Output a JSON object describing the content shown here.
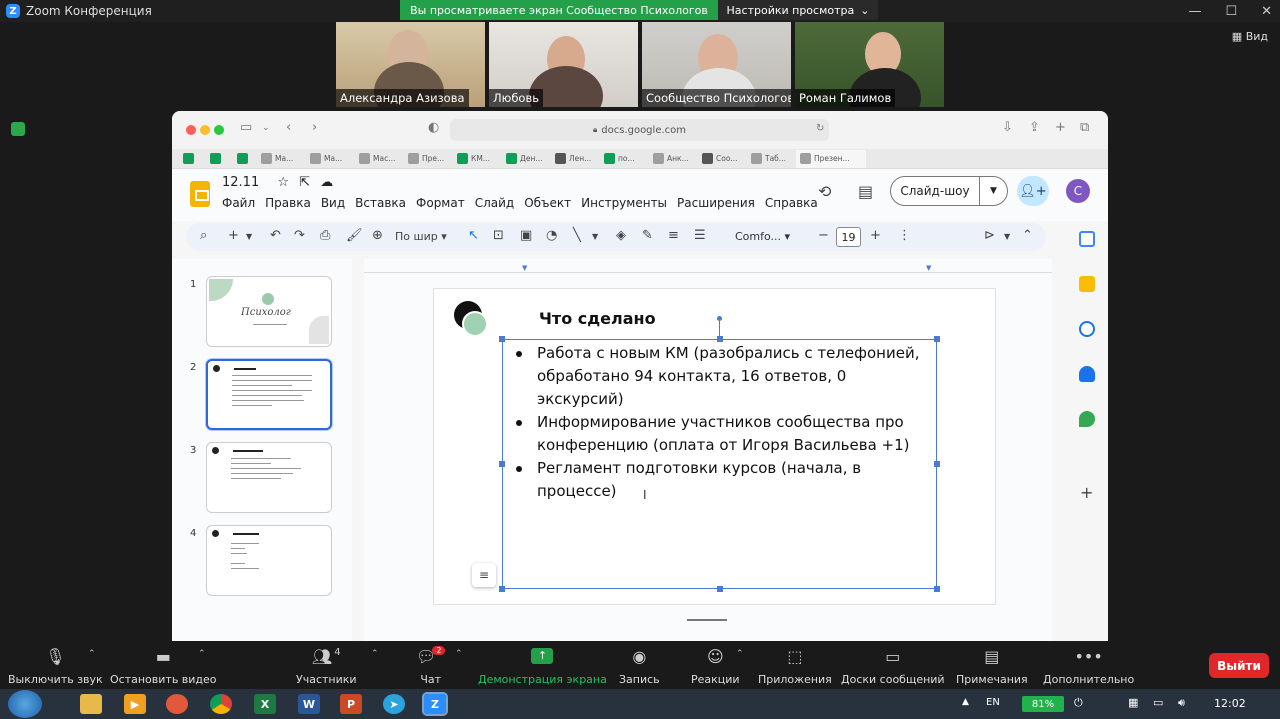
{
  "window": {
    "title": "Zoom Конференция",
    "view_label": "Вид"
  },
  "banner": {
    "text": "Вы просматриваете экран Сообщество Психологов",
    "view_options": "Настройки просмотра"
  },
  "participants_tiles": [
    {
      "name": "Александра Азизова"
    },
    {
      "name": "Любовь"
    },
    {
      "name": "Сообщество Психологов"
    },
    {
      "name": "Роман Галимов"
    }
  ],
  "browser": {
    "address": "docs.google.com",
    "tabs": [
      {
        "label": "",
        "color": "#0f9d58"
      },
      {
        "label": "",
        "color": "#0f9d58"
      },
      {
        "label": "",
        "color": "#0f9d58"
      },
      {
        "label": "Ма...",
        "color": "#9e9e9e"
      },
      {
        "label": "Ма...",
        "color": "#9e9e9e"
      },
      {
        "label": "Мас...",
        "color": "#9e9e9e"
      },
      {
        "label": "Пре...",
        "color": "#9e9e9e"
      },
      {
        "label": "КМ...",
        "color": "#0f9d58"
      },
      {
        "label": "Ден...",
        "color": "#0f9d58"
      },
      {
        "label": "Лен...",
        "color": "#555555"
      },
      {
        "label": "по...",
        "color": "#0f9d58"
      },
      {
        "label": "Анк...",
        "color": "#9e9e9e"
      },
      {
        "label": "Соо...",
        "color": "#555555"
      },
      {
        "label": "Таб...",
        "color": "#9e9e9e"
      },
      {
        "label": "Презен...",
        "color": "#9e9e9e"
      }
    ]
  },
  "slides": {
    "doc_title": "12.11",
    "menu": [
      "Файл",
      "Правка",
      "Вид",
      "Вставка",
      "Формат",
      "Слайд",
      "Объект",
      "Инструменты",
      "Расширения",
      "Справка"
    ],
    "slideshow_label": "Слайд-шоу",
    "avatar_letter": "С",
    "zoom_label": "По шир",
    "font_name": "Comfo...",
    "font_size": "19",
    "thumbnails": [
      {
        "num": "1",
        "caption": "Психолог"
      },
      {
        "num": "2"
      },
      {
        "num": "3"
      },
      {
        "num": "4"
      }
    ],
    "slide_title": "Что сделано",
    "bullets": [
      "Работа с новым КМ (разобрались с телефонией, обработано 94 контакта, 16 ответов, 0 экскурсий)",
      "Информирование участников сообщества про конференцию (оплата от Игоря Васильева +1)",
      "Регламент подготовки курсов (начала, в процессе)"
    ]
  },
  "zoom_bar": {
    "mute": "Выключить звук",
    "video": "Остановить видео",
    "participants": "Участники",
    "participants_count": "4",
    "chat": "Чат",
    "chat_badge": "2",
    "share": "Демонстрация экрана",
    "record": "Запись",
    "reactions": "Реакции",
    "apps": "Приложения",
    "whiteboards": "Доски сообщений",
    "notes": "Примечания",
    "more": "Дополнительно",
    "leave": "Выйти"
  },
  "taskbar": {
    "lang": "EN",
    "battery": "81%",
    "clock": "12:02"
  }
}
